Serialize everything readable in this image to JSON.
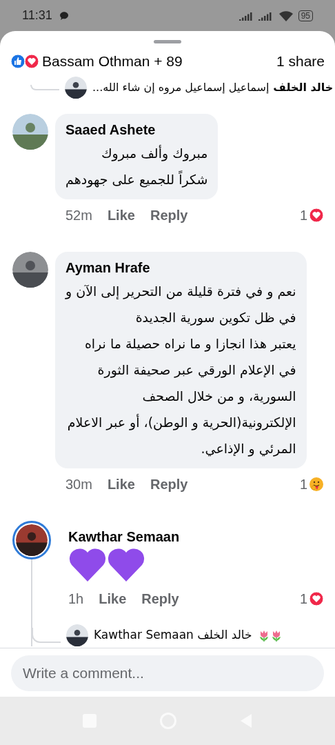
{
  "status_bar": {
    "time": "11:31",
    "battery": "95"
  },
  "header": {
    "reactors": "Bassam Othman + 89",
    "shares": "1 share"
  },
  "top_reply": {
    "author": "خالد الخلف",
    "text": "إسماعيل إسماعيل مروه إن شاء الله..."
  },
  "comments": [
    {
      "author": "Saaed Ashete",
      "story_ring": false,
      "body": {
        "kind": "text",
        "lines": [
          "مبروك وألف مبروك",
          "شكراً للجميع على جهودهم"
        ]
      },
      "time": "52m",
      "like": "Like",
      "reply": "Reply",
      "reaction": {
        "kind": "love",
        "count": "1"
      }
    },
    {
      "author": "Ayman Hrafe",
      "story_ring": false,
      "body": {
        "kind": "text",
        "lines": [
          "نعم و في فترة قليلة من التحرير إلى الآن و",
          "في ظل تكوين سورية الجديدة",
          "يعتبر هذا انجازا و ما نراه حصيلة ما نراه",
          "في الإعلام الورقي عبر صحيفة الثورة",
          "السورية،  و من خلال الصحف",
          "الإلكترونية(الحرية و الوطن)، أو عبر الاعلام",
          "المرئي و الإذاعي."
        ]
      },
      "time": "30m",
      "like": "Like",
      "reply": "Reply",
      "reaction": {
        "kind": "care",
        "count": "1"
      }
    },
    {
      "author": "Kawthar Semaan",
      "story_ring": true,
      "body": {
        "kind": "emoji"
      },
      "time": "1h",
      "like": "Like",
      "reply": "Reply",
      "reaction": {
        "kind": "love",
        "count": "1"
      },
      "reply_preview": {
        "text": "خالد الخلف Kawthar Semaan"
      }
    }
  ],
  "composer": {
    "placeholder": "Write a comment..."
  }
}
